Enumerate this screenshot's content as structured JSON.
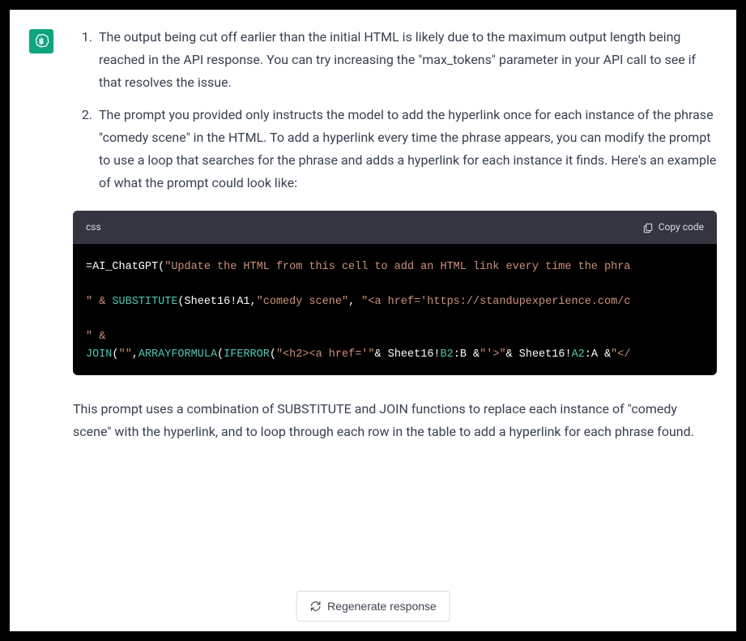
{
  "message": {
    "list_items": [
      "The output being cut off earlier than the initial HTML is likely due to the maximum output length being reached in the API response. You can try increasing the \"max_tokens\" parameter in your API call to see if that resolves the issue.",
      "The prompt you provided only instructs the model to add the hyperlink once for each instance of the phrase \"comedy scene\" in the HTML. To add a hyperlink every time the phrase appears, you can modify the prompt to use a loop that searches for the phrase and adds a hyperlink for each instance it finds. Here's an example of what the prompt could look like:"
    ],
    "closing": "This prompt uses a combination of SUBSTITUTE and JOIN functions to replace each instance of \"comedy scene\" with the hyperlink, and to loop through each row in the table to add a hyperlink for each phrase found."
  },
  "code": {
    "language": "css",
    "copy_label": "Copy code",
    "line1_a": "=AI_ChatGPT(",
    "line1_b": "\"Update the HTML from this cell to add an HTML link every time the phra",
    "line3_a": "\" & ",
    "line3_b": "SUBSTITUTE",
    "line3_c": "(Sheet16!A1,",
    "line3_d": "\"comedy scene\"",
    "line3_e": ", ",
    "line3_f": "\"<a href='https://standupexperience.com/c",
    "line5_a": "\" &",
    "line6_a": "JOIN",
    "line6_b": "(",
    "line6_c": "\"\"",
    "line6_d": ",",
    "line6_e": "ARRAYFORMULA",
    "line6_f": "(",
    "line6_g": "IFERROR",
    "line6_h": "(",
    "line6_i": "\"<h2><a href='\"",
    "line6_j": "& Sheet16!",
    "line6_k": "B2",
    "line6_l": ":B &",
    "line6_m": "\"'>\"",
    "line6_n": "& Sheet16!",
    "line6_o": "A2",
    "line6_p": ":A &",
    "line6_q": "\"</"
  },
  "regenerate": {
    "label": "Regenerate response"
  }
}
